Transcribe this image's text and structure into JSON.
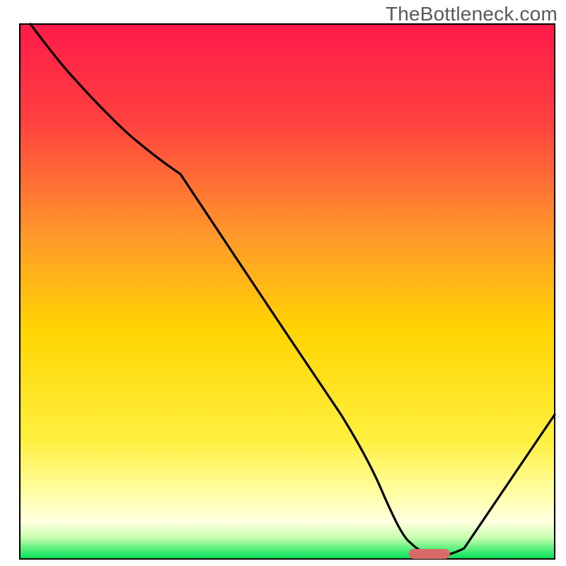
{
  "watermark": "TheBottleneck.com",
  "chart_data": {
    "type": "line",
    "title": "",
    "xlabel": "",
    "ylabel": "",
    "xlim": [
      0,
      100
    ],
    "ylim": [
      0,
      100
    ],
    "grid": false,
    "legend": false,
    "x": [
      2,
      10,
      22,
      30,
      40,
      50,
      60,
      68,
      73,
      78,
      83,
      100
    ],
    "values": [
      100,
      90,
      78,
      72,
      57,
      42,
      27,
      12,
      3,
      0.5,
      2,
      27
    ],
    "marker": {
      "x_range": [
        73,
        80
      ],
      "y": 0.8,
      "color": "#d96a6a"
    },
    "background_gradient": {
      "top": "#ff1a4a",
      "mid_upper": "#ff8a2a",
      "mid": "#ffd400",
      "mid_lower": "#fff27a",
      "lower": "#ffffd0",
      "bottom": "#00e05a"
    },
    "line_color": "#000000"
  }
}
